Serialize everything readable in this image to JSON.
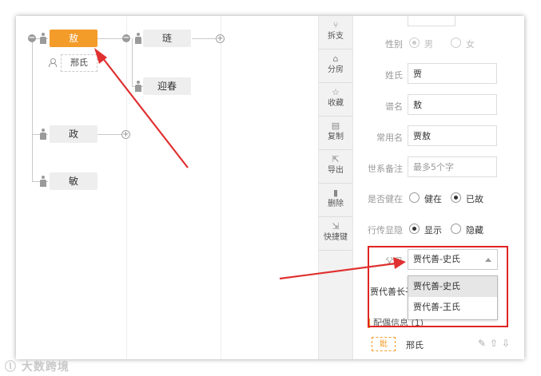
{
  "tree": {
    "nodes": [
      {
        "name": "敖"
      },
      {
        "name": "琏"
      },
      {
        "name": "迎春"
      },
      {
        "name": "政"
      },
      {
        "name": "敏"
      }
    ],
    "spouse_label": "邢氏"
  },
  "toolbar": {
    "items": [
      {
        "label": "拆支",
        "icon": "split-icon"
      },
      {
        "label": "分房",
        "icon": "house-icon"
      },
      {
        "label": "收藏",
        "icon": "star-icon"
      },
      {
        "label": "复制",
        "icon": "copy-icon"
      },
      {
        "label": "导出",
        "icon": "export-icon"
      },
      {
        "label": "删除",
        "icon": "trash-icon"
      },
      {
        "label": "快捷键",
        "icon": "shortcut-icon"
      }
    ]
  },
  "form": {
    "gender": {
      "label": "性别",
      "options": [
        "男",
        "女"
      ],
      "selected": "男"
    },
    "surname": {
      "label": "姓氏",
      "value": "贾"
    },
    "genealogy_name": {
      "label": "谱名",
      "value": "敖"
    },
    "common_name": {
      "label": "常用名",
      "value": "贾敖"
    },
    "lineage_note": {
      "label": "世系备注",
      "placeholder": "最多5个字"
    },
    "alive": {
      "label": "是否健在",
      "options": [
        "健在",
        "已故"
      ],
      "selected": "已故"
    },
    "biography": {
      "label": "行传显隐",
      "options": [
        "显示",
        "隐藏"
      ],
      "selected": "显示"
    },
    "parents": {
      "label": "父母",
      "selected": "贾代善-史氏",
      "options": [
        "贾代善-史氏",
        "贾代善-王氏"
      ]
    },
    "eldest_label": "贾代善长子",
    "spouse_section": "配偶信息 (1)",
    "spouse": {
      "tag": "妣",
      "name": "邢氏"
    }
  },
  "watermark": "大数跨境",
  "colors": {
    "accent": "#f39c29",
    "highlight_box": "#e02424",
    "arrow": "#e03030"
  }
}
